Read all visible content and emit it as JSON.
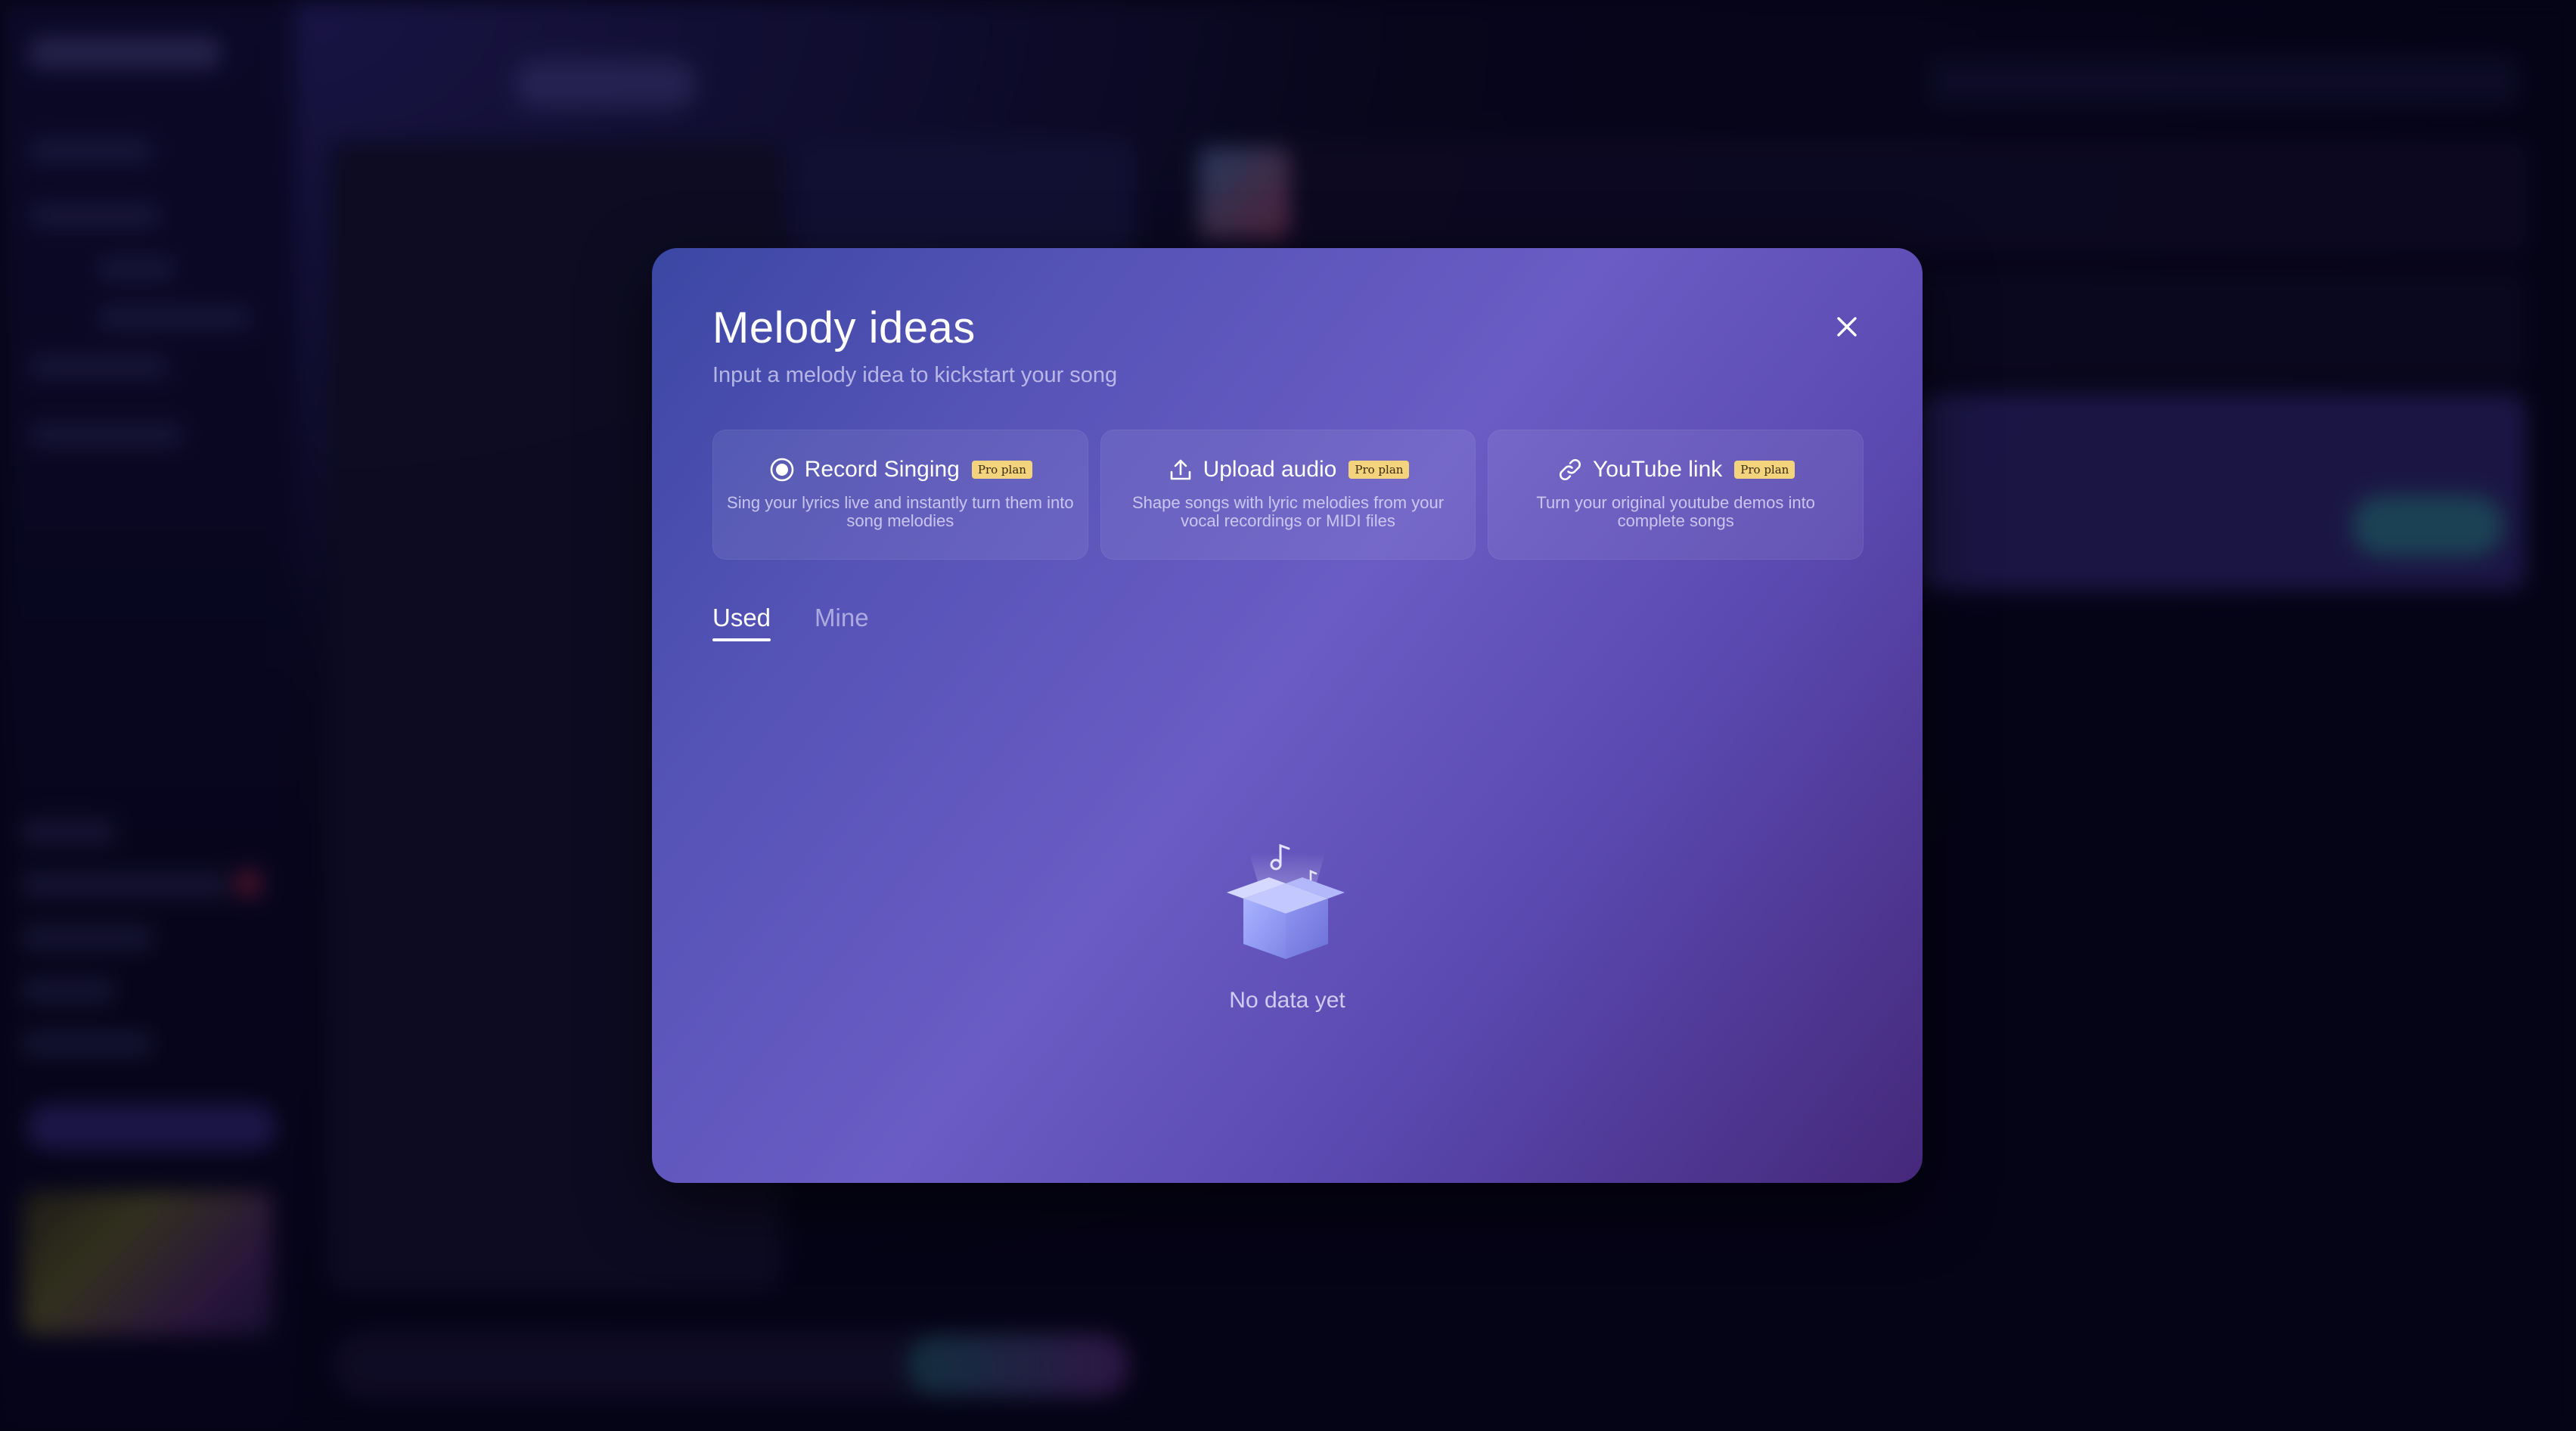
{
  "modal": {
    "title": "Melody ideas",
    "subtitle": "Input a melody idea to kickstart your song",
    "close_icon": "close-icon",
    "options": [
      {
        "icon": "record-icon",
        "title": "Record Singing",
        "badge": "Pro plan",
        "description": "Sing your lyrics live and instantly turn them into song melodies"
      },
      {
        "icon": "upload-icon",
        "title": "Upload audio",
        "badge": "Pro plan",
        "description": "Shape songs with lyric melodies from your vocal recordings or MIDI files"
      },
      {
        "icon": "link-icon",
        "title": "YouTube link",
        "badge": "Pro plan",
        "description": "Turn your original youtube demos into complete songs"
      }
    ],
    "tabs": [
      {
        "label": "Used",
        "active": true
      },
      {
        "label": "Mine",
        "active": false
      }
    ],
    "empty_state": {
      "icon": "empty-box-icon",
      "text": "No data yet"
    }
  },
  "colors": {
    "badge_bg": "#f3d37b",
    "modal_gradient_start": "#3b47a4",
    "modal_gradient_end": "#45287a"
  }
}
